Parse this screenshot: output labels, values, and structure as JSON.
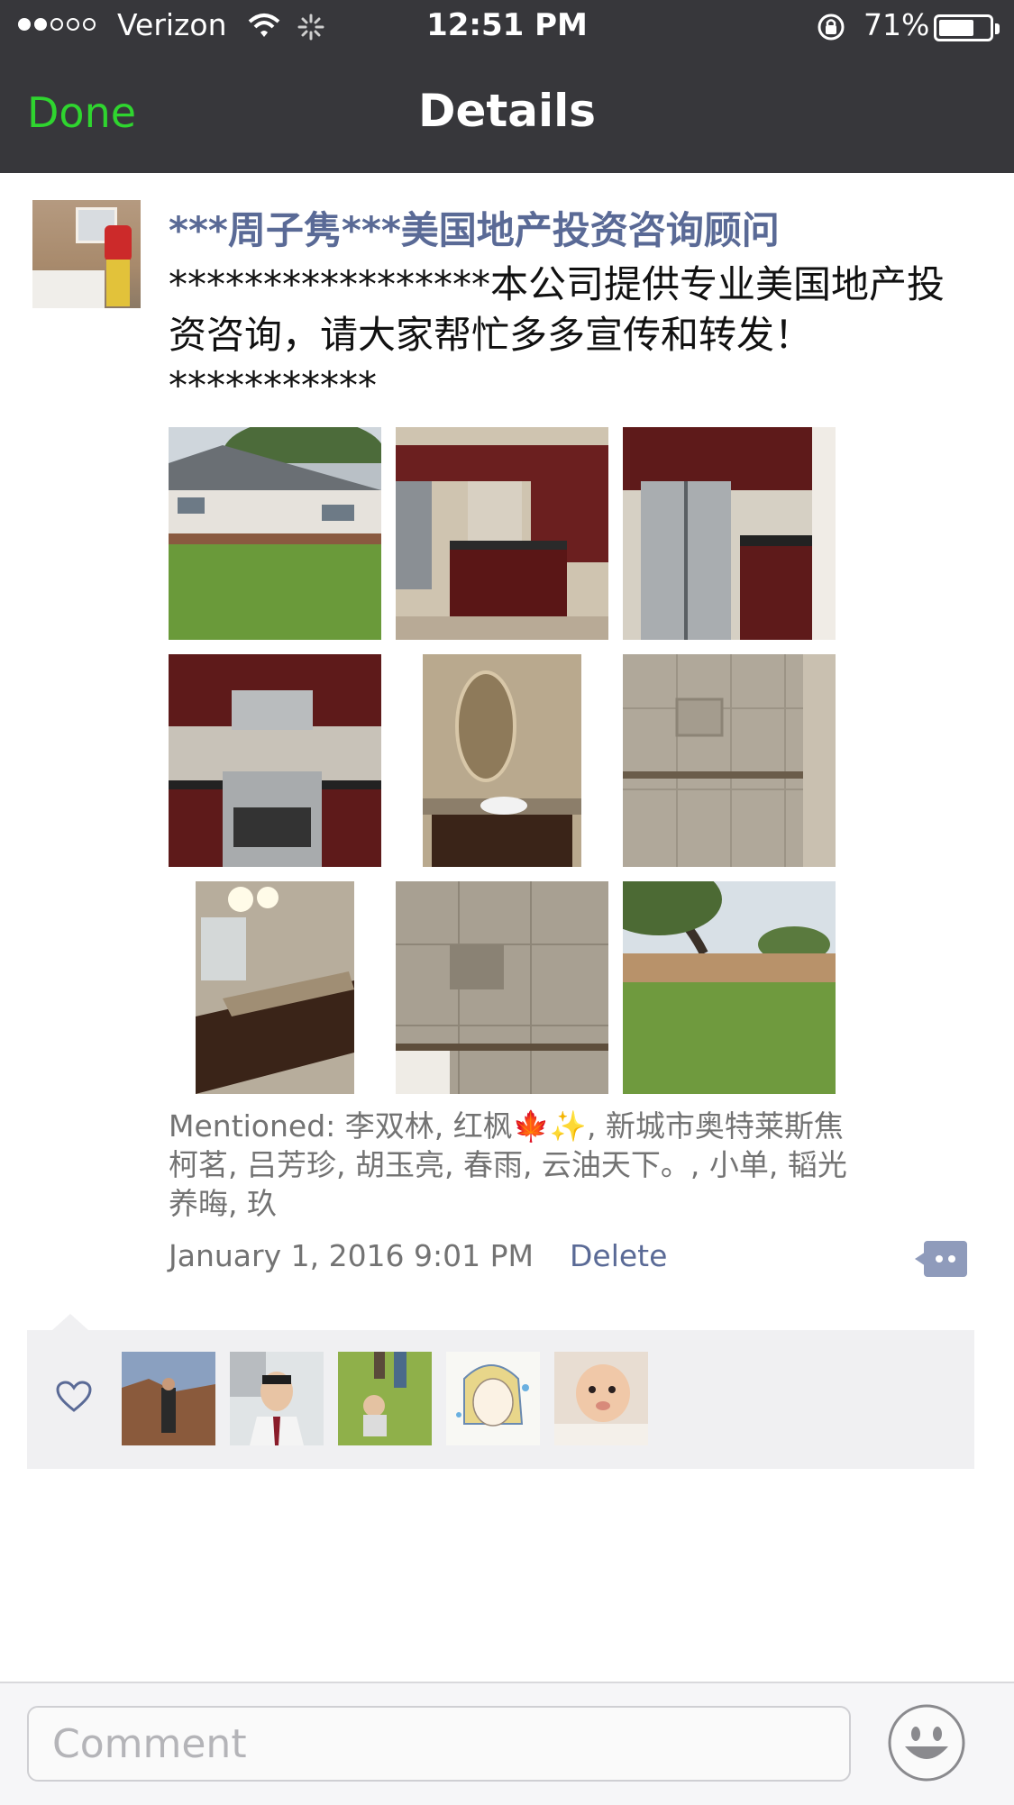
{
  "status_bar": {
    "carrier": "Verizon",
    "time": "12:51 PM",
    "battery_percent": "71%",
    "battery_level": 0.71
  },
  "nav": {
    "done_label": "Done",
    "title": "Details"
  },
  "post": {
    "author": "***周子隽***美国地产投资咨询顾问",
    "text": "*****************本公司提供专业美国地产投资咨询，请大家帮忙多多宣传和转发！***********",
    "photos": [
      "house-exterior-photo",
      "kitchen-island-photo",
      "refrigerator-photo",
      "stove-photo",
      "bathroom-vanity-photo",
      "tiled-shower-photo",
      "double-vanity-photo",
      "tile-wall-photo",
      "backyard-photo"
    ],
    "mentioned_label": "Mentioned:",
    "mentioned_names": "李双林, 红枫🍁✨, 新城市奥特莱斯焦柯茗, 吕芳珍, 胡玉亮, 春雨, 云油天下。, 小单, 韬光养晦, 玖",
    "timestamp": "January 1, 2016 9:01 PM",
    "delete_label": "Delete"
  },
  "likes": {
    "icon": "heart-icon",
    "avatars": [
      "liker-avatar-1",
      "liker-avatar-2",
      "liker-avatar-3",
      "liker-avatar-4",
      "liker-avatar-5"
    ]
  },
  "comment_bar": {
    "placeholder": "Comment",
    "emoji_icon": "emoji-icon"
  },
  "colors": {
    "nav_background": "#37373b",
    "accent_green": "#2fd52f",
    "link_blue": "#5a6a96",
    "likes_background": "#f0f0f2"
  }
}
